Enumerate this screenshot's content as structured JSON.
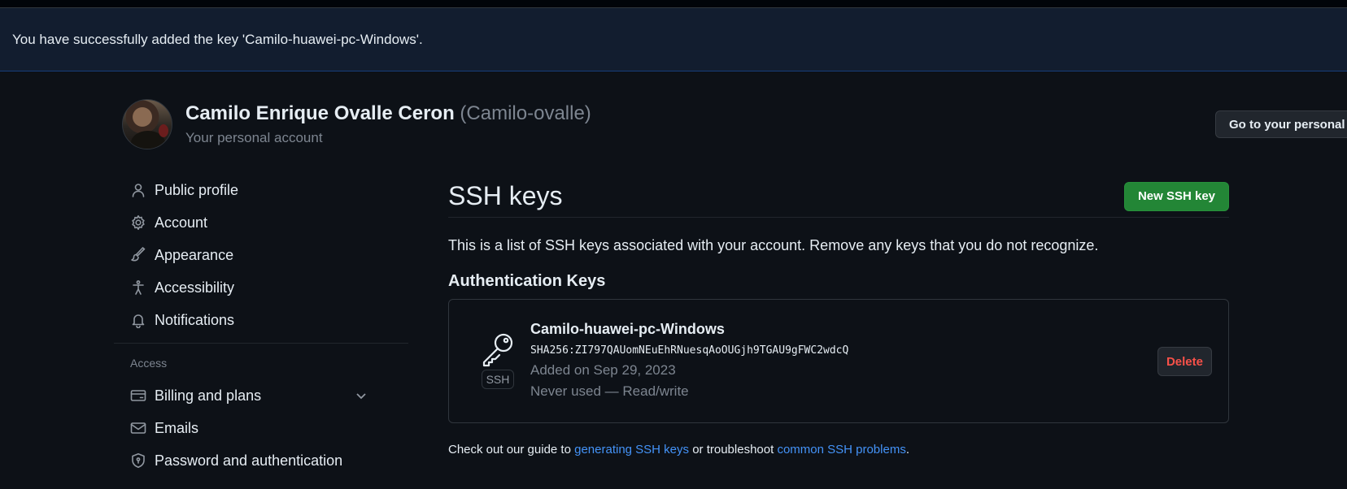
{
  "flash": {
    "message": "You have successfully added the key 'Camilo-huawei-pc-Windows'."
  },
  "profile": {
    "name": "Camilo Enrique Ovalle Ceron",
    "login": "(Camilo-ovalle)",
    "subtitle": "Your personal account",
    "personal_profile_button": "Go to your personal profile"
  },
  "sidebar": {
    "items": [
      {
        "label": "Public profile",
        "icon": "person-icon"
      },
      {
        "label": "Account",
        "icon": "gear-icon"
      },
      {
        "label": "Appearance",
        "icon": "paintbrush-icon"
      },
      {
        "label": "Accessibility",
        "icon": "accessibility-icon"
      },
      {
        "label": "Notifications",
        "icon": "bell-icon"
      }
    ],
    "access_label": "Access",
    "access_items": [
      {
        "label": "Billing and plans",
        "icon": "credit-card-icon"
      },
      {
        "label": "Emails",
        "icon": "mail-icon"
      },
      {
        "label": "Password and authentication",
        "icon": "shield-lock-icon"
      }
    ]
  },
  "main": {
    "title": "SSH keys",
    "new_key_button": "New SSH key",
    "description": "This is a list of SSH keys associated with your account. Remove any keys that you do not recognize.",
    "auth_keys_title": "Authentication Keys",
    "key": {
      "name": "Camilo-huawei-pc-Windows",
      "fingerprint": "SHA256:ZI797QAUomNEuEhRNuesqAoOUGjh9TGAU9gFWC2wdcQ",
      "added": "Added on Sep 29, 2023",
      "usage": "Never used — Read/write",
      "badge": "SSH",
      "delete_label": "Delete"
    },
    "footer": {
      "prefix": "Check out our guide to ",
      "link1": "generating SSH keys",
      "middle": " or troubleshoot ",
      "link2": "common SSH problems",
      "suffix": "."
    }
  },
  "colors": {
    "background": "#0d1117",
    "flash_bg": "#121d2f",
    "primary_button": "#238636",
    "danger_text": "#f85149",
    "link": "#4493f8"
  }
}
